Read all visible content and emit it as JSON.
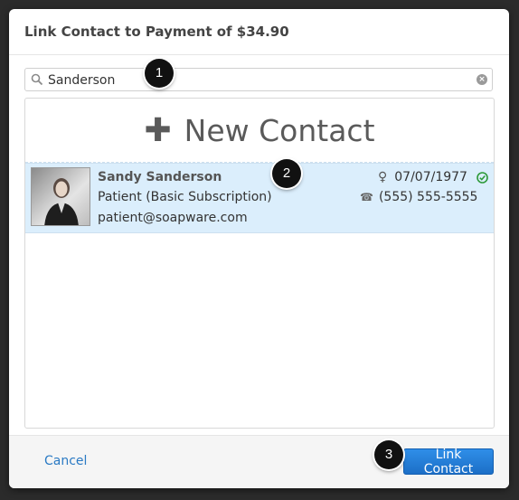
{
  "dialog": {
    "title": "Link Contact to Payment of $34.90"
  },
  "search": {
    "value": "Sanderson",
    "icon": "search-icon",
    "clear_icon": "clear-icon"
  },
  "new_contact": {
    "label": "New Contact",
    "icon": "plus-icon"
  },
  "results": [
    {
      "name": "Sandy Sanderson",
      "subscription": "Patient (Basic Subscription)",
      "email": "patient@soapware.com",
      "dob": "07/07/1977",
      "phone": "(555) 555-5555",
      "gender_icon": "female-icon",
      "verified_icon": "check-circle-icon"
    }
  ],
  "footer": {
    "cancel_label": "Cancel",
    "link_label": "Link Contact"
  },
  "callouts": [
    "1",
    "2",
    "3"
  ],
  "colors": {
    "accent": "#1c6fc7",
    "selected_row": "#dbeefc",
    "link": "#2a7ac4",
    "verified": "#2e9a3a"
  }
}
